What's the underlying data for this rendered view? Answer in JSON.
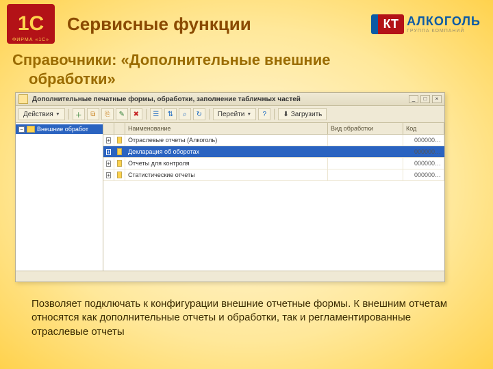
{
  "header": {
    "title": "Сервисные функции",
    "logo_1c_text": "1C",
    "logo_1c_sub": "ФИРМА «1С»",
    "logo_kt": "КТ",
    "logo_alko": "АЛКОГОЛЬ",
    "logo_alko_sub": "ГРУППА КОМПАНИЙ"
  },
  "subheading_line1": "Справочники: «Дополнительные внешние",
  "subheading_line2": "обработки»",
  "window": {
    "title": "Дополнительные печатные формы, обработки, заполнение табличных частей",
    "toolbar": {
      "actions_label": "Действия",
      "goto_label": "Перейти",
      "load_label": "Загрузить"
    },
    "tree": {
      "root": {
        "label": "Внешние обработ",
        "expanded": true
      }
    },
    "columns": {
      "name": "Наименование",
      "kind": "Вид обработки",
      "code": "Код"
    },
    "rows": [
      {
        "label": "Отраслевые отчеты (Алкоголь)",
        "kind": "",
        "code": "000000…",
        "selected": false
      },
      {
        "label": "Декларация об оборотах",
        "kind": "",
        "code": "000000…",
        "selected": true
      },
      {
        "label": "Отчеты для контроля",
        "kind": "",
        "code": "000000…",
        "selected": false
      },
      {
        "label": "Статистические отчеты",
        "kind": "",
        "code": "000000…",
        "selected": false
      }
    ]
  },
  "caption": "Позволяет подключать к конфигурации внешние отчетные формы. К внешним отчетам относятся как дополнительные отчеты и обработки, так и регламентированные отраслевые отчеты"
}
